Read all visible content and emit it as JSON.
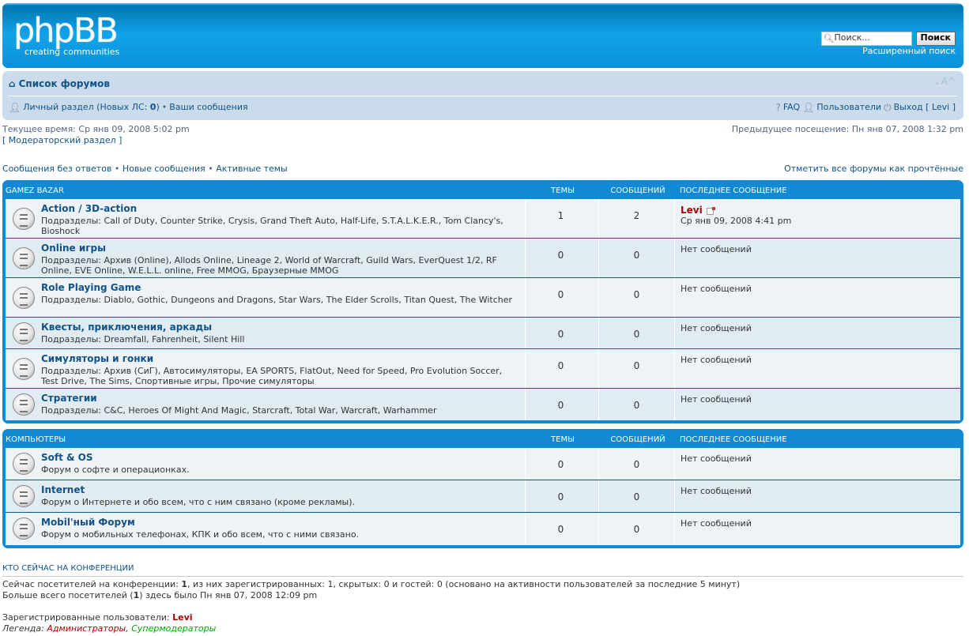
{
  "header": {
    "logo_main": "phpBB",
    "logo_sub1": "creating",
    "logo_sub2": "communities",
    "search_placeholder": "Поиск...",
    "search_button": "Поиск",
    "advanced_search": "Расширенный поиск"
  },
  "navbar": {
    "forum_index": "Список форумов",
    "font_resize": "⌄A^",
    "ucp": "Личный раздел (Новых ЛС: ",
    "ucp_count": "0",
    "ucp_close": ")",
    "your_posts": "Ваши сообщения",
    "faq": "FAQ",
    "members": "Пользователи",
    "logout": "Выход [ Levi ]"
  },
  "info": {
    "current_time": "Текущее время: Ср янв 09, 2008 5:02 pm",
    "last_visit": "Предыдущее посещение: Пн янв 07, 2008 1:32 pm",
    "mcp": "[ Модераторский раздел ]",
    "unanswered": "Сообщения без ответов",
    "new_posts": "Новые сообщения",
    "active_topics": "Активные темы",
    "mark_read": "Отметить все форумы как прочтённые"
  },
  "columns": {
    "topics": "Темы",
    "posts": "Сообщений",
    "last_post": "Последнее сообщение"
  },
  "categories": [
    {
      "name": "Gamez Bazar",
      "forums": [
        {
          "title": "Action / 3D-action",
          "desc": "Подразделы: Call of Duty, Counter Strike, Crysis, Grand Theft Auto, Half-Life, S.T.A.L.K.E.R., Tom Clancy's, Bioshock",
          "topics": "1",
          "posts": "2",
          "last_author": "Levi",
          "last_time": "Ср янв 09, 2008 4:41 pm"
        },
        {
          "title": "Online игры",
          "desc": "Подразделы: Архив (Online), Allods Online, Lineage 2, World of Warcraft, Guild Wars, EverQuest 1/2, RF Online, EVE Online, W.E.L.L. online, Free MMOG, Браузерные MMOG",
          "topics": "0",
          "posts": "0",
          "last_none": "Нет сообщений"
        },
        {
          "title": "Role Playing Game",
          "desc": "Подразделы: Diablo, Gothic, Dungeons and Dragons, Star Wars, The Elder Scrolls, Titan Quest, The Witcher",
          "topics": "0",
          "posts": "0",
          "last_none": "Нет сообщений"
        },
        {
          "title": "Квесты, приключения, аркады",
          "desc": "Подразделы: Dreamfall, Fahrenheit, Silent Hill",
          "topics": "0",
          "posts": "0",
          "last_none": "Нет сообщений"
        },
        {
          "title": "Симуляторы и гонки",
          "desc": "Подразделы: Архив (СиГ), Автосимуляторы, EA SPORTS, FlatOut, Need for Speed, Pro Evolution Soccer, Test Drive, The Sims, Спортивные игры, Прочие симуляторы",
          "topics": "0",
          "posts": "0",
          "last_none": "Нет сообщений"
        },
        {
          "title": "Стратегии",
          "desc": "Подразделы: C&C, Heroes Of Might And Magic, Starcraft, Total War, Warcraft, Warhammer",
          "topics": "0",
          "posts": "0",
          "last_none": "Нет сообщений"
        }
      ]
    },
    {
      "name": "Компьютеры",
      "forums": [
        {
          "title": "Soft & OS",
          "desc": "Форум о софте и операционках.",
          "topics": "0",
          "posts": "0",
          "last_none": "Нет сообщений"
        },
        {
          "title": "Internet",
          "desc": "Форум о Интернете и обо всем, что с ним связано (кроме рекламы).",
          "topics": "0",
          "posts": "0",
          "last_none": "Нет сообщений"
        },
        {
          "title": "Mobil'ный Форум",
          "desc": "Форум о мобильных телефонах, КПК и обо всем, что с ними связано.",
          "topics": "0",
          "posts": "0",
          "last_none": "Нет сообщений"
        }
      ]
    }
  ],
  "who": {
    "title": "Кто сейчас на конференции",
    "online_pre": "Сейчас посетителей на конференции: ",
    "online_total": "1",
    "online_rest": ", из них зарегистрированных: 1, скрытых: 0 и гостей: 0 (основано на активности пользователей за последние 5 минут)",
    "record_pre": "Больше всего посетителей (",
    "record_count": "1",
    "record_rest": ") здесь было Пн янв 07, 2008 12:09 pm",
    "registered_label": "Зарегистрированные пользователи: ",
    "registered_user": "Levi",
    "legend_label": "Легенда: ",
    "legend_admins": "Администраторы",
    "legend_sep": ", ",
    "legend_smods": "Супермодераторы"
  }
}
